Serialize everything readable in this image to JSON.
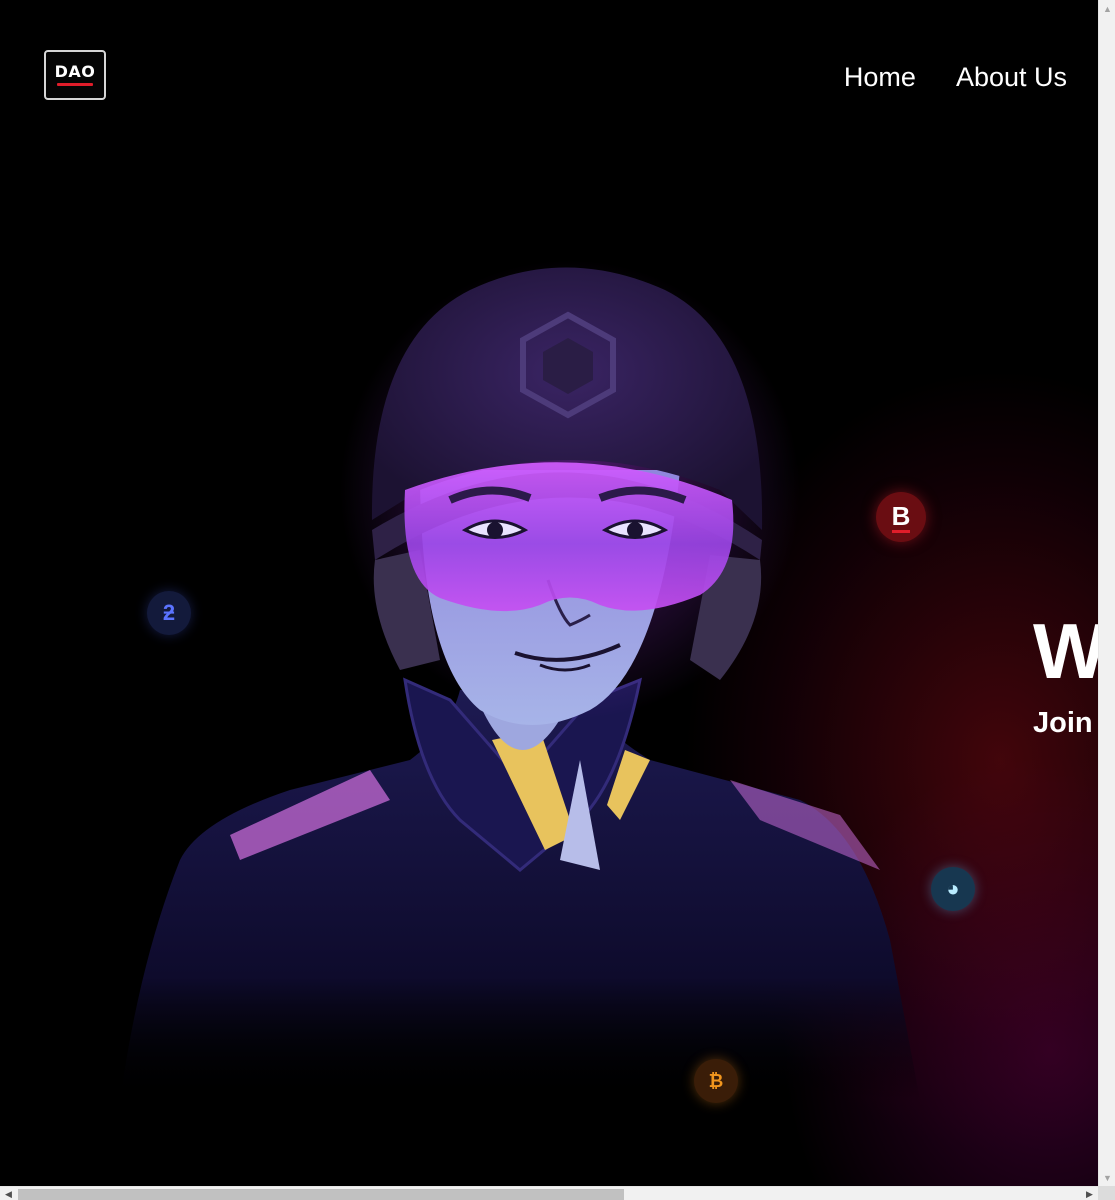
{
  "header": {
    "logo_text": "DAO",
    "nav": [
      {
        "label": "Home"
      },
      {
        "label": "About Us"
      }
    ]
  },
  "hero": {
    "headline": "W",
    "subheadline": "Join"
  },
  "coins": {
    "blue_glyph": "ƻ",
    "red_glyph": "B",
    "cyan_glyph": "◕",
    "orange_glyph": "₿"
  },
  "colors": {
    "background": "#000000",
    "accent_red": "#e01d2a",
    "visor_purple": "#c040f0",
    "coin_orange": "#f2961e",
    "coin_blue": "#5b73ff"
  },
  "scrollbar": {
    "up": "▲",
    "down": "▼",
    "left": "◀",
    "right": "▶",
    "horizontal_position": 0
  }
}
